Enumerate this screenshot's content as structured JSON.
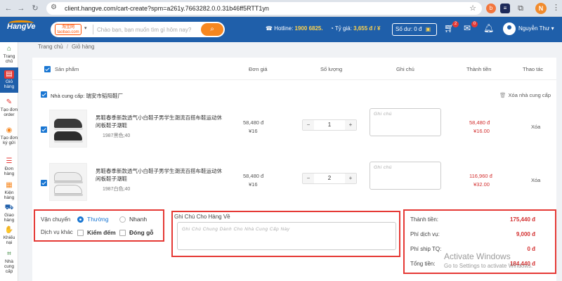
{
  "browser": {
    "url": "client.hangve.com/cart-create?spm=a261y.7663282.0.0.31b46ff5RTT1yn",
    "profile_initial": "N"
  },
  "header": {
    "logo": "HangVe",
    "source": "淘宝网 taobao.com",
    "search_placeholder": "Chào bạn, bạn muốn tìm gì hôm nay?",
    "hotline_label": "Hotline:",
    "hotline_value": "1900 6825.",
    "rate_label": "Tỷ giá:",
    "rate_value": "3,655 đ / ¥",
    "balance": "Số dư: 0 đ",
    "cart_count": "2",
    "mail_count": "0",
    "user_name": "Nguyễn Thư"
  },
  "sidebar": {
    "items": [
      {
        "label": "Trang chủ",
        "icon": "home-icon"
      },
      {
        "label": "Giỏ hàng",
        "icon": "cart-icon"
      },
      {
        "label": "Tạo đơn order",
        "icon": "create-order-icon"
      },
      {
        "label": "Tạo đơn ký gửi",
        "icon": "consign-icon"
      },
      {
        "label": "Đơn hàng",
        "icon": "orders-icon"
      },
      {
        "label": "Kiện hàng",
        "icon": "package-icon"
      },
      {
        "label": "Giao hàng",
        "icon": "delivery-icon"
      },
      {
        "label": "Khiếu nại",
        "icon": "complaint-icon"
      },
      {
        "label": "Nhà cung cấp",
        "icon": "supplier-icon"
      }
    ]
  },
  "breadcrumb": {
    "home": "Trang chủ",
    "current": "Giỏ hàng"
  },
  "table": {
    "headers": {
      "product": "Sản phẩm",
      "unit_price": "Đơn giá",
      "quantity": "Số lượng",
      "note": "Ghi chú",
      "total": "Thành tiền",
      "action": "Thao tác"
    },
    "supplier_label": "Nhà cung cấp: 瑞安市韬阳鞋厂",
    "remove_supplier": "Xóa nhà cung cấp",
    "items": [
      {
        "name": "男鞋春季新款透气小白鞋子男学生潮流百搭布鞋运动休闲板鞋子潮鞋",
        "variant": "1987黑色;40",
        "price_vnd": "58,480 đ",
        "price_cny": "¥16",
        "qty": "1",
        "note_placeholder": "Ghi chú",
        "total_vnd": "58,480 đ",
        "total_cny": "¥16.00",
        "delete": "Xóa"
      },
      {
        "name": "男鞋春季新款透气小白鞋子男学生潮流百搭布鞋运动休闲板鞋子潮鞋",
        "variant": "1987白色;40",
        "price_vnd": "58,480 đ",
        "price_cny": "¥16",
        "qty": "2",
        "note_placeholder": "Ghi chú",
        "total_vnd": "116,960 đ",
        "total_cny": "¥32.00",
        "delete": "Xóa"
      }
    ]
  },
  "shipping": {
    "transport_label": "Vận chuyển",
    "normal": "Thường",
    "fast": "Nhanh",
    "services_label": "Dịch vụ khác",
    "inspection": "Kiểm đếm",
    "wood_packing": "Đóng gỗ"
  },
  "shipping_note": {
    "title": "Ghi Chú Cho Hàng Về",
    "placeholder": "Ghi Chú Chung Dành Cho Nhà Cung Cấp Này"
  },
  "summary": {
    "subtotal_label": "Thành tiền:",
    "subtotal": "175,440 đ",
    "service_fee_label": "Phí dịch vụ:",
    "service_fee": "9,000 đ",
    "ship_cn_label": "Phí ship TQ:",
    "ship_cn": "0 đ",
    "grand_total_label": "Tổng tiền:",
    "grand_total": "184,440 đ"
  },
  "watermark": {
    "line1": "Activate Windows",
    "line2": "Go to Settings to activate Windows."
  },
  "colors": {
    "brand": "#1f5faa",
    "accent": "#f7871f",
    "alert": "#e53935"
  }
}
